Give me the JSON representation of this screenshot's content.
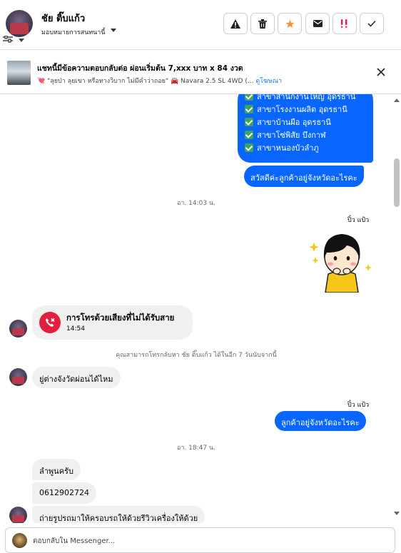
{
  "header": {
    "contact_name": "ชัย ติ๊บแก้ว",
    "assign_label": "มอบหมายการสนทนานี้",
    "actions": [
      {
        "name": "report-spam-button",
        "icon": "warning-icon"
      },
      {
        "name": "delete-button",
        "icon": "trash-icon"
      },
      {
        "name": "star-button",
        "icon": "star-icon"
      },
      {
        "name": "mark-unread-button",
        "icon": "envelope-icon"
      },
      {
        "name": "follow-up-button",
        "icon": "follow-up-icon"
      },
      {
        "name": "mark-done-button",
        "icon": "check-icon"
      }
    ]
  },
  "ad": {
    "title": "แชทนี้มีข้อความตอบกลับต่อ ผ่อนเริ่มต้น 7,xxx บาท x 84 งวด",
    "subtitle": "💘 \"ลุยป่า ลุยเขา หรือทางวิบาก ไม่มีคำว่าถอย\" 🚘 Navara 2.5 SL 4WD (...",
    "link_label": "ดูโฆษณา"
  },
  "colors": {
    "accent": "#0866ff",
    "incoming_bubble": "#f0f0f0",
    "missed_call": "#e41e3f",
    "check_green": "#3aa757",
    "star_orange": "#f7923b",
    "followup_red": "#e41e3f"
  },
  "messages": {
    "branch_list": [
      "สาขาสำนักงานใหญ่ อุดรธานี",
      "สาขาโรงงานผลิต อุดรธานี",
      "สาขาบ้านผือ อุดรธานี",
      "สาขาโซ่พิสัย บึงกาฬ",
      "สาขาหนองบัวลำภู"
    ],
    "greeting": "สวัสดีค่ะลูกค้าอยู่จังหวัดอะไรคะ",
    "time_1": "อา. 14:03 น.",
    "sender_1": "ปิ๋ว แป้ว",
    "call_title": "การโทรด้วยเสียงที่ไม่ได้รับสาย",
    "call_time": "14:54",
    "callback_note": "คุณสามารถโทรกลับหา ชัย ติ๊บแก้ว ได้ในอีก 7 วันนับจากนี้",
    "incoming_1": "ยู่ต่างจังวัดผ่อนได้ไหม",
    "sender_2": "ปิ๋ว แป้ว",
    "outgoing_2": "ลูกค้าอยู่จังหวัดอะไรคะ",
    "time_2": "อา. 18:47 น.",
    "incoming_2": "ลำพูนครับ",
    "incoming_3": "0612902724",
    "incoming_4": "ถ่ายรูปรถมาให้ครอบรถให้ด้วยรีวิวเครื่องให้ด้วย"
  },
  "composer": {
    "placeholder": "ตอบกลับใน Messenger..."
  }
}
